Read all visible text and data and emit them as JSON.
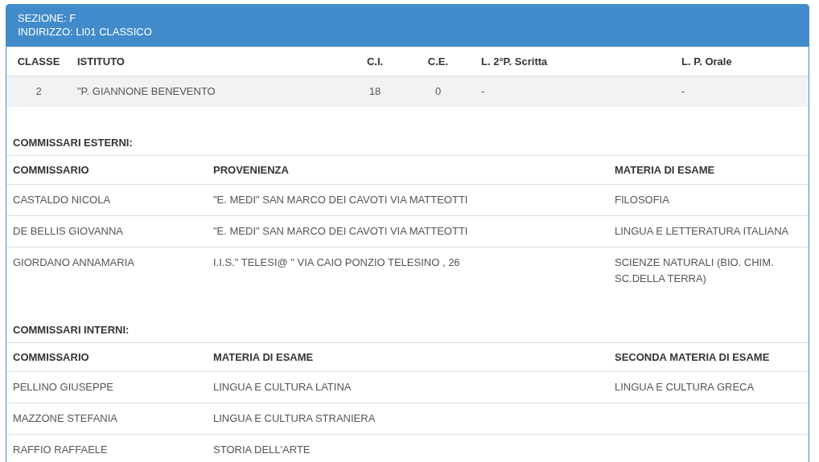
{
  "header": {
    "lines": [
      "SEZIONE: F",
      "INDIRIZZO: LI01 CLASSICO"
    ]
  },
  "classes": {
    "columns": [
      "CLASSE",
      "ISTITUTO",
      "C.I.",
      "C.E.",
      "L. 2°P. Scritta",
      "L. P. Orale"
    ],
    "rows": [
      [
        "2",
        "\"P. GIANNONE BENEVENTO",
        "18",
        "0",
        "-",
        "-"
      ]
    ]
  },
  "sections": [
    {
      "title": "COMMISSARI ESTERNI:",
      "columns": [
        "COMMISSARIO",
        "PROVENIENZA",
        "MATERIA DI ESAME"
      ],
      "rows": [
        [
          "CASTALDO NICOLA",
          "\"E. MEDI\" SAN MARCO DEI CAVOTI VIA MATTEOTTI",
          "FILOSOFIA"
        ],
        [
          "DE BELLIS GIOVANNA",
          "\"E. MEDI\" SAN MARCO DEI CAVOTI VIA MATTEOTTI",
          "LINGUA E LETTERATURA ITALIANA"
        ],
        [
          "GIORDANO ANNAMARIA",
          "I.I.S.\" TELESI@ \" VIA CAIO PONZIO TELESINO , 26",
          "SCIENZE NATURALI (BIO. CHIM. SC.DELLA TERRA)"
        ]
      ]
    },
    {
      "title": "COMMISSARI INTERNI:",
      "columns": [
        "COMMISSARIO",
        "MATERIA DI ESAME",
        "SECONDA MATERIA DI ESAME"
      ],
      "rows": [
        [
          "PELLINO GIUSEPPE",
          "LINGUA E CULTURA LATINA",
          "LINGUA E CULTURA GRECA"
        ],
        [
          "MAZZONE STEFANIA",
          "LINGUA E CULTURA STRANIERA"
        ],
        [
          "RAFFIO RAFFAELE",
          "STORIA DELL'ARTE"
        ]
      ]
    }
  ]
}
